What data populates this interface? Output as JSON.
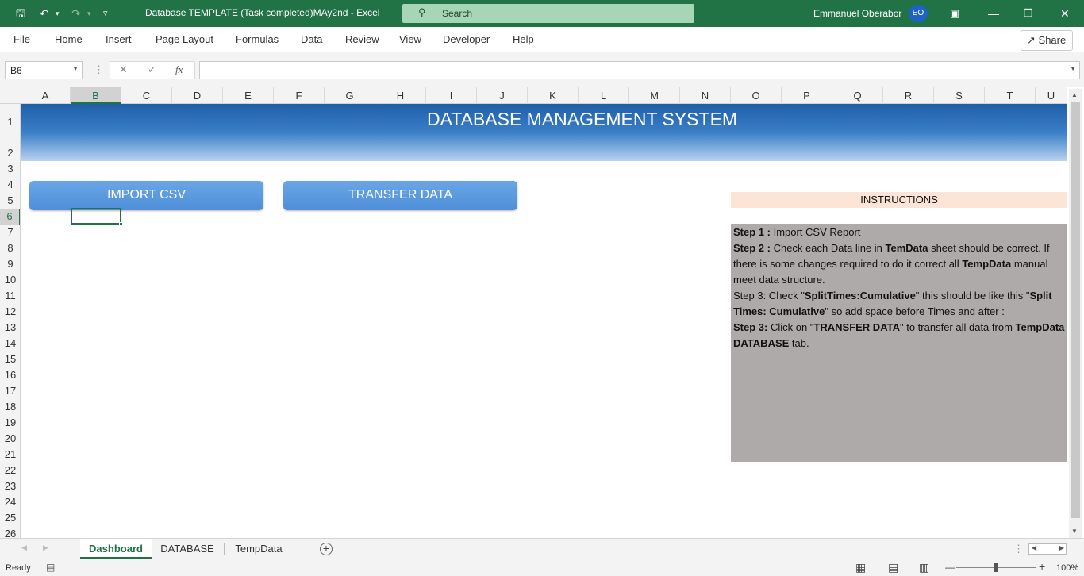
{
  "window": {
    "title": "Database TEMPLATE (Task completed)MAy2nd  -  Excel",
    "search_placeholder": "Search",
    "user_name": "Emmanuel Oberabor",
    "user_initials": "EO"
  },
  "menu": {
    "items": [
      "File",
      "Home",
      "Insert",
      "Page Layout",
      "Formulas",
      "Data",
      "Review",
      "View",
      "Developer",
      "Help"
    ],
    "share_label": "Share"
  },
  "formula_bar": {
    "name_box": "B6",
    "fx_label": "fx",
    "formula": ""
  },
  "columns": [
    "A",
    "B",
    "C",
    "D",
    "E",
    "F",
    "G",
    "H",
    "I",
    "J",
    "K",
    "L",
    "M",
    "N",
    "O",
    "P",
    "Q",
    "R",
    "S",
    "T",
    "U"
  ],
  "rows": [
    "1",
    "2",
    "3",
    "4",
    "5",
    "6",
    "7",
    "8",
    "9",
    "10",
    "11",
    "12",
    "13",
    "14",
    "15",
    "16",
    "17",
    "18",
    "19",
    "20",
    "21",
    "22",
    "23",
    "24",
    "25",
    "26"
  ],
  "selected_cell": {
    "column": "B",
    "row": "6"
  },
  "sheet": {
    "banner_title": "DATABASE MANAGEMENT SYSTEM",
    "import_button": "IMPORT CSV",
    "transfer_button": "TRANSFER DATA",
    "instructions_title": "INSTRUCTIONS",
    "instructions": {
      "step1_label": "Step 1 :",
      "step1_text": " Import CSV Report",
      "step2_label": "Step 2 :",
      "step2_text_a": " Check each Data line in ",
      "step2_bold_a": "TemData",
      "step2_text_b": " sheet should be correct. If",
      "step2_text_c": "there is some changes required to do it correct all ",
      "step2_bold_b": "TempData",
      "step2_text_d": " manual",
      "step2_text_e": "meet data structure.",
      "step3a_text_a": "Step 3: Check \"",
      "step3a_bold_a": "SplitTimes:Cumulative",
      "step3a_text_b": "\" this should be like this \"",
      "step3a_bold_b": "Split",
      "step3a_bold_c": "Times: Cumulative",
      "step3a_text_c": "\" so add space before Times and after :",
      "step3b_label": "Step 3:",
      "step3b_text_a": " Click on \"",
      "step3b_bold_a": "TRANSFER DATA",
      "step3b_text_b": "\" to transfer all data from ",
      "step3b_bold_b": "TempData",
      "step3b_bold_c": "DATABASE",
      "step3b_text_c": " tab."
    }
  },
  "sheet_tabs": [
    "Dashboard",
    "DATABASE",
    "TempData"
  ],
  "active_tab": "Dashboard",
  "status": {
    "ready": "Ready",
    "zoom": "100%"
  },
  "colors": {
    "excel_green": "#217346",
    "banner_top": "#1f5fa8",
    "button_blue": "#5b9be0",
    "instructions_header_bg": "#fce4d6",
    "instructions_body_bg": "#aeaaaa"
  }
}
